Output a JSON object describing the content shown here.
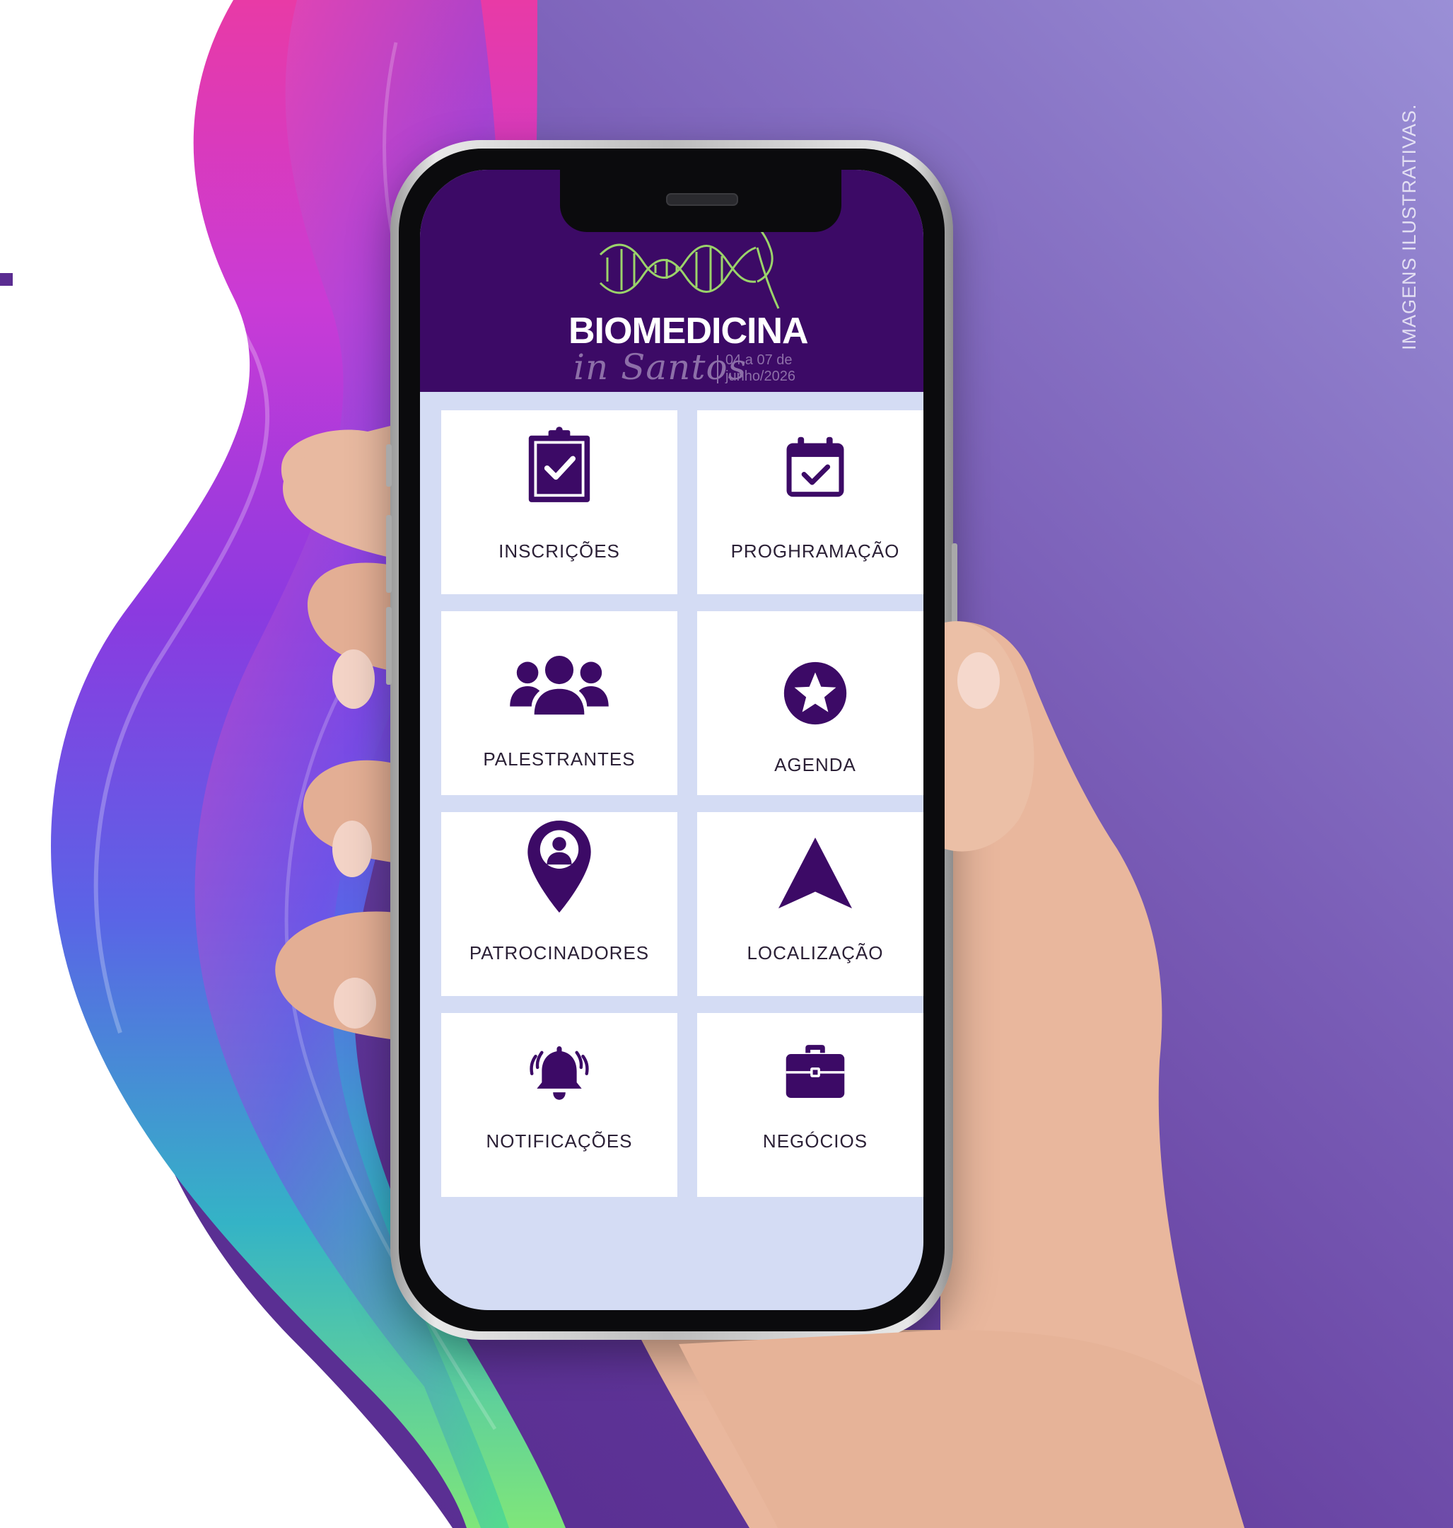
{
  "disclaimer": "IMAGENS ILUSTRATIVAS.",
  "colors": {
    "header": "#3c0a66",
    "screen_bg": "#d4dcf4",
    "icon": "#3c0a66",
    "tile_bg": "#ffffff",
    "dna_green": "#9bd36a"
  },
  "app": {
    "logo": {
      "title": "BIOMEDICINA",
      "subtitle": "in Santos",
      "date_line1": "04 a 07 de",
      "date_line2": "junho/2026"
    },
    "menu": [
      {
        "id": "inscricoes",
        "label": "INSCRIÇÕES",
        "icon": "clipboard-check-icon"
      },
      {
        "id": "programacao",
        "label": "PROGHRAMAÇÃO",
        "icon": "calendar-check-icon"
      },
      {
        "id": "palestrantes",
        "label": "PALESTRANTES",
        "icon": "users-group-icon"
      },
      {
        "id": "agenda",
        "label": "AGENDA",
        "icon": "star-circle-icon"
      },
      {
        "id": "patrocinadores",
        "label": "PATROCINADORES",
        "icon": "location-pin-user-icon"
      },
      {
        "id": "localizacao",
        "label": "LOCALIZAÇÃO",
        "icon": "navigation-arrow-icon"
      },
      {
        "id": "notificacoes",
        "label": "NOTIFICAÇÕES",
        "icon": "bell-ringing-icon"
      },
      {
        "id": "negocios",
        "label": "NEGÓCIOS",
        "icon": "briefcase-icon"
      }
    ]
  }
}
